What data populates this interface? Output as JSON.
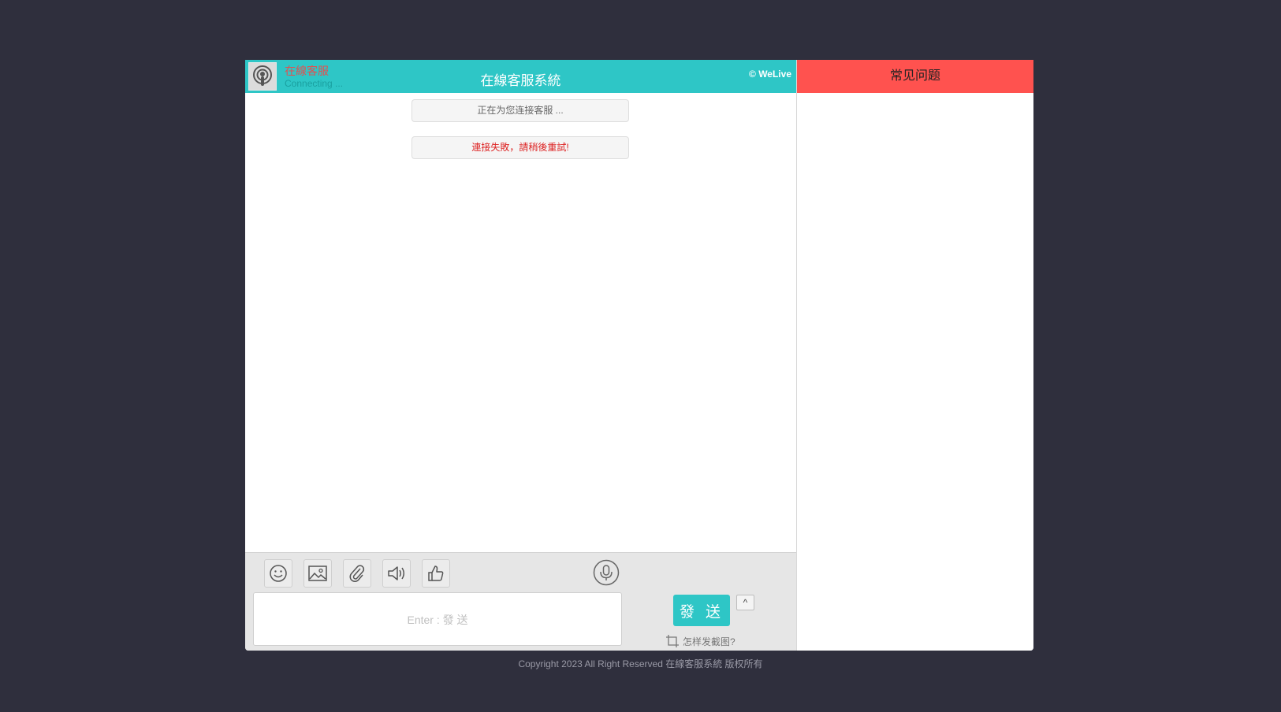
{
  "chat": {
    "agent_name": "在線客服",
    "agent_status": "Connecting ...",
    "title": "在線客服系統",
    "brand": "© WeLive",
    "messages": [
      {
        "text": "正在为您连接客服 ..."
      },
      {
        "text": "連接失敗，請稍後重試!"
      }
    ]
  },
  "composer": {
    "tools": [
      "smile-icon",
      "image-icon",
      "paperclip-icon",
      "speaker-icon",
      "thumbs-up-icon",
      "microphone-icon"
    ],
    "input_placeholder": "Enter : 發 送",
    "send_label": "發 送",
    "toggle_label": "^",
    "screenshot_hint": "怎样发截图?"
  },
  "faq": {
    "title": "常见问题"
  },
  "footer": {
    "copyright": "Copyright 2023 All Right Reserved 在線客服系統 版权所有"
  },
  "colors": {
    "header_teal": "#2ec6c6",
    "faq_red": "#ff524f",
    "background": "#2f2f3d",
    "error_text": "#dd2222"
  }
}
